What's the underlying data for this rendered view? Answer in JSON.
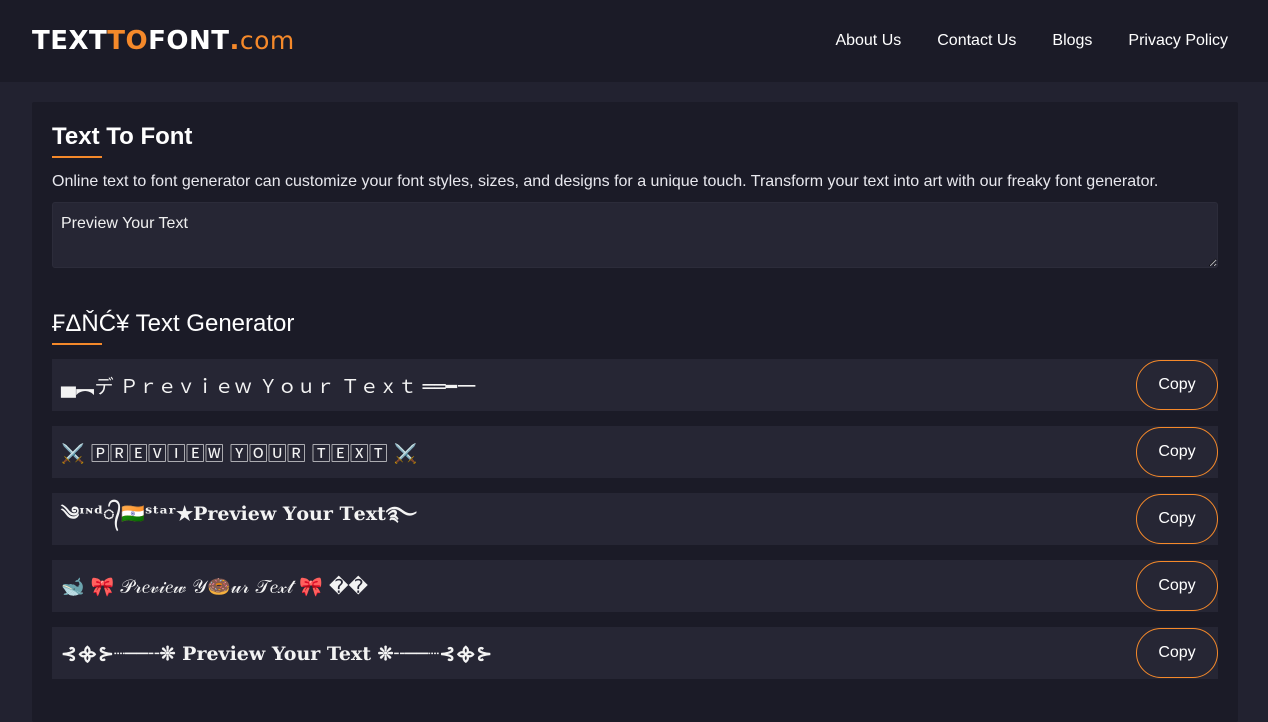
{
  "logo": {
    "part1": "TEXT",
    "part2": "TO",
    "part3": "FONT",
    "dot": ".",
    "suffix": "com"
  },
  "nav": {
    "items": [
      {
        "label": "About Us"
      },
      {
        "label": "Contact Us"
      },
      {
        "label": "Blogs"
      },
      {
        "label": "Privacy Policy"
      }
    ]
  },
  "main": {
    "title": "Text To Font",
    "description": "Online text to font generator can customize your font styles, sizes, and designs for a unique touch. Transform your text into art with our freaky font generator.",
    "input_value": "Preview Your Text"
  },
  "generator": {
    "title": "₣ΔŇĆ¥ Text Generator",
    "copy_label": "Copy",
    "rows": [
      {
        "text": "▄︻デ Ｐｒｅｖｉｅｗ Ｙｏｕｒ Ｔｅｘｔ ══━一"
      },
      {
        "text": "⚔️ 🄿🅁🄴🅅🄸🄴🅆 🅈🄾🅄🅁 🅃🄴🅇🅃 ⚔️"
      },
      {
        "text": "༄ᶦᶰᵈ᭄🇮🇳ˢᵗᵃʳ★𝐏𝐫𝐞𝐯𝐢𝐞𝐰 𝐘𝐨𝐮𝐫 𝐓𝐞𝐱𝐭࿐"
      },
      {
        "text": "🐋 🎀 𝒫𝓇𝑒𝓋𝒾𝑒𝓌 𝒴🍩𝓊𝓇 𝒯𝑒𝓍𝓉 🎀 ��"
      },
      {
        "text": "⊰᯽⊱┈──╌❊ Preview Your Text ❊╌──┈⊰᯽⊱"
      }
    ]
  }
}
